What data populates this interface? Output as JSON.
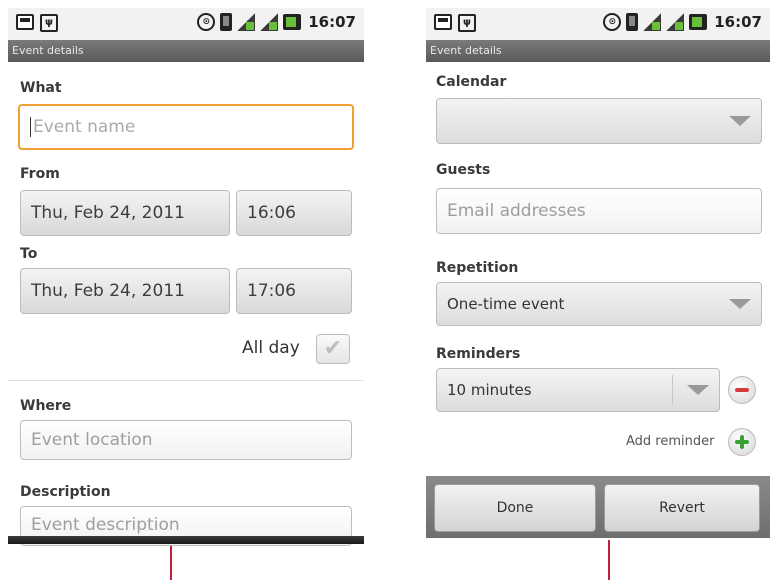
{
  "left": {
    "status_time": "16:07",
    "title": "Event details",
    "what_label": "What",
    "what_placeholder": "Event name",
    "from_label": "From",
    "from_date": "Thu, Feb 24, 2011",
    "from_time": "16:06",
    "to_label": "To",
    "to_date": "Thu, Feb 24, 2011",
    "to_time": "17:06",
    "allday_label": "All day",
    "where_label": "Where",
    "where_placeholder": "Event location",
    "description_label": "Description",
    "description_placeholder": "Event description"
  },
  "right": {
    "status_time": "16:07",
    "title": "Event details",
    "calendar_label": "Calendar",
    "calendar_value": "",
    "guests_label": "Guests",
    "guests_placeholder": "Email addresses",
    "repetition_label": "Repetition",
    "repetition_value": "One-time event",
    "reminders_label": "Reminders",
    "reminder_value": "10 minutes",
    "add_reminder_label": "Add reminder",
    "done_label": "Done",
    "revert_label": "Revert"
  },
  "colors": {
    "focus": "#f0a032",
    "marker": "#c0203a",
    "remove": "#d23c3c",
    "add": "#3ba035"
  }
}
